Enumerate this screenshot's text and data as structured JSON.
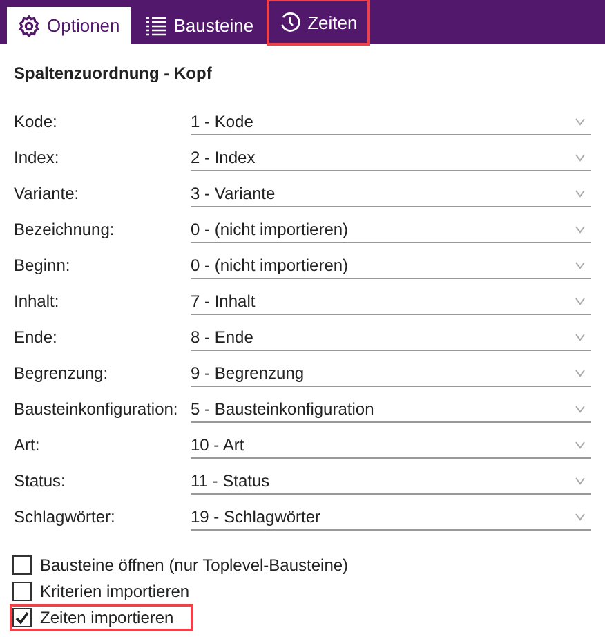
{
  "tabs": [
    {
      "label": "Optionen",
      "kind": "gear",
      "selected": true,
      "highlighted": false
    },
    {
      "label": "Bausteine",
      "kind": "list",
      "selected": false,
      "highlighted": false
    },
    {
      "label": "Zeiten",
      "kind": "clock",
      "selected": false,
      "highlighted": true
    }
  ],
  "section_title": "Spaltenzuordnung - Kopf",
  "fields": [
    {
      "label": "Kode:",
      "value": "1 - Kode"
    },
    {
      "label": "Index:",
      "value": "2 - Index"
    },
    {
      "label": "Variante:",
      "value": "3 - Variante"
    },
    {
      "label": "Bezeichnung:",
      "value": "0 - (nicht importieren)"
    },
    {
      "label": "Beginn:",
      "value": "0 - (nicht importieren)"
    },
    {
      "label": "Inhalt:",
      "value": "7 - Inhalt"
    },
    {
      "label": "Ende:",
      "value": "8 - Ende"
    },
    {
      "label": "Begrenzung:",
      "value": "9 - Begrenzung"
    },
    {
      "label": "Bausteinkonfiguration:",
      "value": "5 - Bausteinkonfiguration"
    },
    {
      "label": "Art:",
      "value": "10 - Art"
    },
    {
      "label": "Status:",
      "value": "11 - Status"
    },
    {
      "label": "Schlagwörter:",
      "value": "19 - Schlagwörter"
    }
  ],
  "checkboxes": [
    {
      "label": "Bausteine öffnen (nur Toplevel-Bausteine)",
      "checked": false,
      "highlighted": false
    },
    {
      "label": "Kriterien importieren",
      "checked": false,
      "highlighted": false
    },
    {
      "label": "Zeiten importieren",
      "checked": true,
      "highlighted": true
    }
  ]
}
